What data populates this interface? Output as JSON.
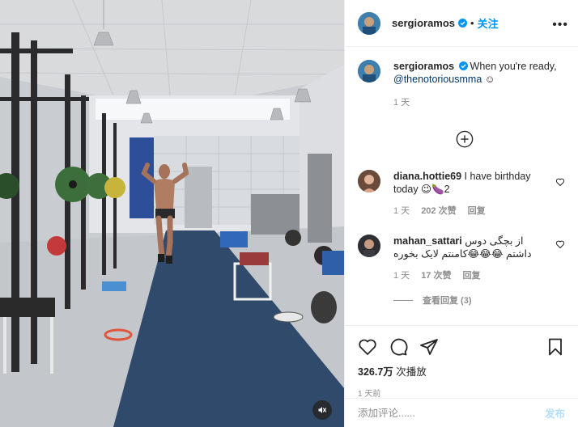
{
  "post": {
    "username": "sergioramos",
    "follow_label": "关注",
    "caption_user": "sergioramos",
    "caption_text": "When you're ready,",
    "caption_mention": "@thenotoriousmma",
    "caption_emoji": "☺",
    "caption_time": "1 天"
  },
  "comments": [
    {
      "user": "diana.hottie69",
      "text": "I have birthday today 😉🍆2",
      "time": "1 天",
      "likes": "202 次赞",
      "reply": "回复"
    },
    {
      "user": "mahan_sattari",
      "text": "از بچگی دوس داشتم 😂😂😂کامنتم لایک بخوره",
      "time": "1 天",
      "likes": "17 次赞",
      "reply": "回复",
      "view_replies": "查看回复 (3)"
    }
  ],
  "stats": {
    "views_count": "326.7万",
    "views_label": "次播放",
    "posted": "1 天前"
  },
  "comment_box": {
    "placeholder": "添加评论......",
    "post_label": "发布"
  },
  "icons": {
    "verified": "verified-badge-icon",
    "more": "more-options-icon",
    "load_more": "plus-circle-icon",
    "like": "heart-icon",
    "comment": "comment-icon",
    "share": "share-icon",
    "save": "bookmark-icon",
    "mute": "muted-speaker-icon"
  },
  "colors": {
    "accent": "#0095f6",
    "post_disabled": "#b2dffc",
    "muted_text": "#8e8e8e",
    "mention": "#00376b"
  }
}
